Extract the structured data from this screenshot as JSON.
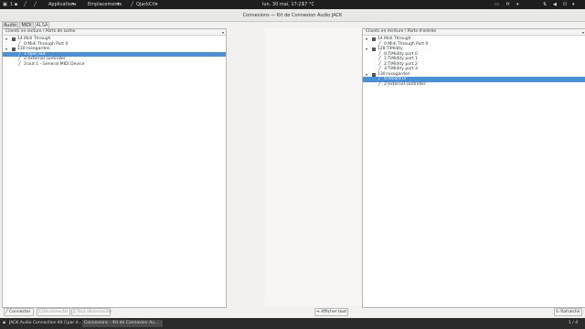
{
  "topbar": {
    "menu_apps": "Applications",
    "menu_places": "Emplacements",
    "app_name": "QjackCtl",
    "datetime": "lun. 30 mai, 17:23",
    "weather": "17 °C",
    "keyboard": "fr"
  },
  "window": {
    "title": "Connexions — Kit de Connexion Audio JACK"
  },
  "tabs": [
    "Audio",
    "MIDI",
    "ALSA"
  ],
  "left_panel": {
    "header": "Clients en lecture / Ports de sortie",
    "rows": [
      {
        "text": "14 Midi Through"
      },
      {
        "text": "0:Midi Through Port 0"
      },
      {
        "text": "130:rosegarden"
      },
      {
        "text": "1:sync out"
      },
      {
        "text": "2:external controller"
      },
      {
        "text": "3:out 1 - General MIDI Device"
      }
    ]
  },
  "right_panel": {
    "header": "Clients en écriture / Ports d'entrée",
    "rows": [
      {
        "text": "14 Midi Through"
      },
      {
        "text": "0:Midi Through Port 0"
      },
      {
        "text": "128:TiMidity"
      },
      {
        "text": "0:TiMidity port 0"
      },
      {
        "text": "1:TiMidity port 1"
      },
      {
        "text": "2:TiMidity port 2"
      },
      {
        "text": "3:TiMidity port 3"
      },
      {
        "text": "130:rosegarden"
      },
      {
        "text": "0:record in"
      },
      {
        "text": "2:external controller"
      }
    ]
  },
  "buttons": {
    "connect": "Connecter",
    "disconnect": "Déconnecter",
    "disconnect_all": "Tout déconnecter",
    "show_all": "Afficher tout",
    "refresh": "Rafraîchir"
  },
  "taskbar": {
    "task1": "JACK Audio Connection Kit [(par d...",
    "task2": "Connexions – Kit de Connexion Au...",
    "workspace": "1 / 4"
  },
  "colors": {
    "selection": "#4a90d9",
    "topbar": "#1e1e1e",
    "taskbar": "#2b2b2b"
  }
}
